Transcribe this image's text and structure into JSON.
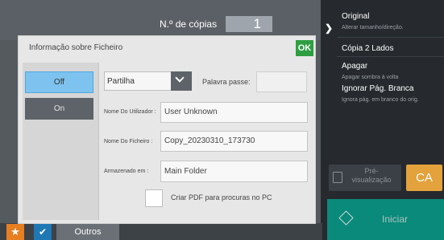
{
  "top": {
    "copies_label": "N.º de cópias",
    "copies_value": "1"
  },
  "right_panel": {
    "items": [
      {
        "label": "Original",
        "sub": "Alterar tamanho/direção."
      },
      {
        "label": "Cópia 2 Lados",
        "sub": ""
      },
      {
        "label": "Apagar",
        "sub": "Apagar sombra à volta"
      },
      {
        "label": "Ignorar Pág. Branca",
        "sub": "Ignora pág. em branco do orig."
      }
    ],
    "preview_label": "Pré-\nvisualização",
    "ca_label": "CA",
    "start_label": "Iniciar"
  },
  "bottom": {
    "others_label": "Outros"
  },
  "dialog": {
    "title": "Informação sobre Ficheiro",
    "ok_label": "OK",
    "off_label": "Off",
    "on_label": "On",
    "share_value": "Partilha",
    "password_label": "Palavra passe:",
    "password_value": "",
    "user_label": "Nome Do Utilizador :",
    "user_value": "User Unknown",
    "file_label": "Nome Do Ficheiro  :",
    "file_value": "Copy_20230310_173730",
    "folder_label": "Armazenado em  :",
    "folder_value": "Main Folder",
    "pdf_label": "Criar PDF para procuras no PC"
  }
}
